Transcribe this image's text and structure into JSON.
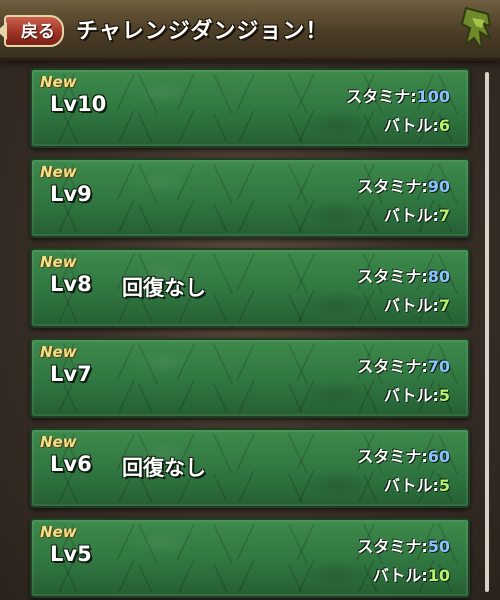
{
  "header": {
    "back_label": "戻る",
    "title": "チャレンジダンジョン！"
  },
  "colors": {
    "stamina_value": "#8ac4ff",
    "battle_value": "#b6f16e",
    "new_badge": "#f1e28a",
    "panel_green": "#2f7440"
  },
  "labels": {
    "new": "New",
    "stamina": "スタミナ:",
    "battle": "バトル:"
  },
  "dungeons": [
    {
      "level": "Lv10",
      "note": "",
      "stamina": "100",
      "battles": "6"
    },
    {
      "level": "Lv9",
      "note": "",
      "stamina": "90",
      "battles": "7"
    },
    {
      "level": "Lv8",
      "note": "回復なし",
      "stamina": "80",
      "battles": "7"
    },
    {
      "level": "Lv7",
      "note": "",
      "stamina": "70",
      "battles": "5"
    },
    {
      "level": "Lv6",
      "note": "回復なし",
      "stamina": "60",
      "battles": "5"
    },
    {
      "level": "Lv5",
      "note": "",
      "stamina": "50",
      "battles": "10"
    }
  ]
}
